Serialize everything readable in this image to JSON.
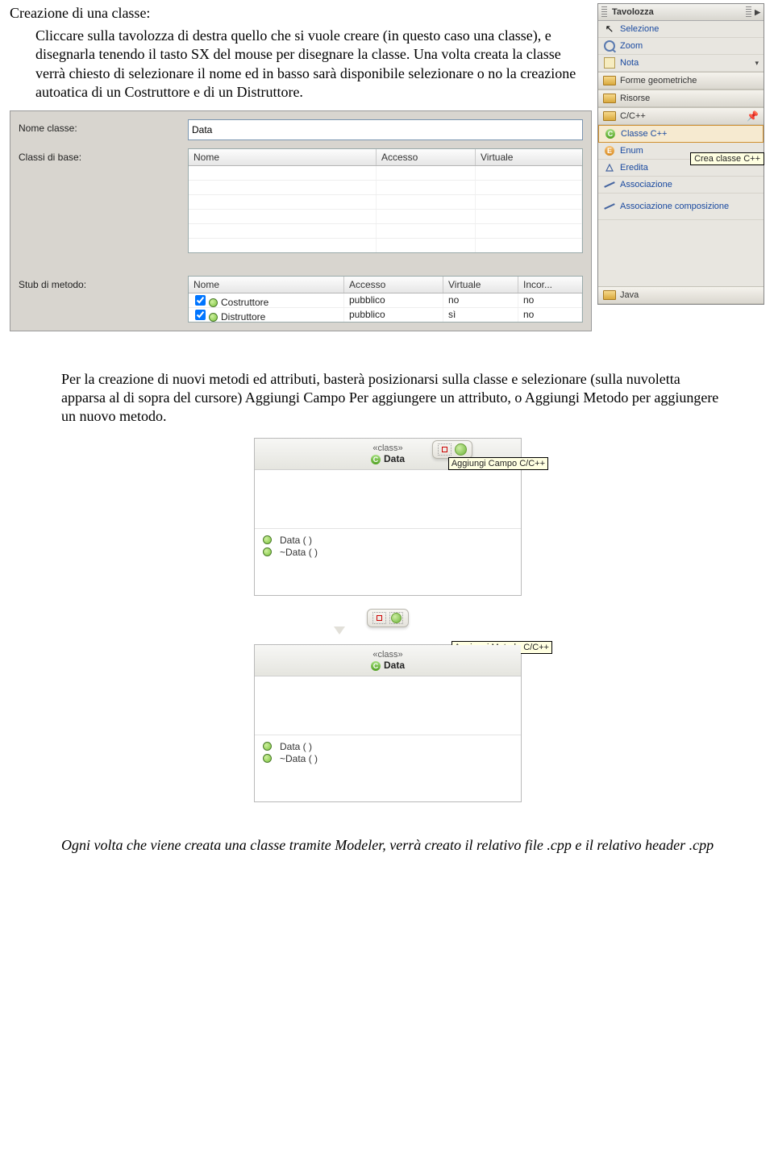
{
  "intro": {
    "heading": "Creazione di una classe:",
    "p1": "Cliccare sulla tavolozza di destra quello che si vuole creare (in questo caso una classe), e disegnarla tenendo il tasto SX del mouse per disegnare la classe. Una volta creata la classe verrà chiesto di selezionare il nome ed in basso sarà disponibile selezionare o no la creazione autoatica di un Costruttore e di un Distruttore."
  },
  "dialog1": {
    "nome_label": "Nome classe:",
    "nome_value": "Data",
    "base_label": "Classi di base:",
    "base_cols": {
      "nome": "Nome",
      "accesso": "Accesso",
      "virtuale": "Virtuale"
    },
    "stub_label": "Stub di metodo:",
    "stub_cols": {
      "nome": "Nome",
      "accesso": "Accesso",
      "virtuale": "Virtuale",
      "incor": "Incor..."
    },
    "stubs": [
      {
        "nome": "Costruttore",
        "accesso": "pubblico",
        "virtuale": "no",
        "incor": "no"
      },
      {
        "nome": "Distruttore",
        "accesso": "pubblico",
        "virtuale": "sì",
        "incor": "no"
      }
    ]
  },
  "palette": {
    "title": "Tavolozza",
    "items_top": [
      {
        "icon": "cursor",
        "label": "Selezione"
      },
      {
        "icon": "zoom",
        "label": "Zoom"
      },
      {
        "icon": "note",
        "label": "Nota",
        "arrow": true
      }
    ],
    "cats": [
      {
        "label": "Forme geometriche"
      },
      {
        "label": "Risorse"
      },
      {
        "label": "C/C++",
        "pin": true
      }
    ],
    "cpp_items": [
      {
        "icon": "cg",
        "label": "Classe C++",
        "selected": true
      },
      {
        "icon": "co",
        "label": "Enum"
      },
      {
        "icon": "tri",
        "label": "Eredita"
      },
      {
        "icon": "line",
        "label": "Associazione"
      },
      {
        "icon": "line",
        "label": "Associazione composizione",
        "multiline": true
      }
    ],
    "java_cat": "Java",
    "tooltip": "Crea classe C++"
  },
  "mid": {
    "p1": "Per la creazione di nuovi metodi ed attributi, basterà posizionarsi sulla classe e selezionare (sulla nuvoletta apparsa al di sopra del cursore) Aggiungi Campo Per aggiungere un attributo, o Aggiungi Metodo per aggiungere un nuovo metodo."
  },
  "class1": {
    "stereo": "«class»",
    "name": "Data",
    "methods": [
      "Data ( )",
      "~Data ( )"
    ],
    "tooltip": "Aggiungi Campo C/C++"
  },
  "class2": {
    "stereo": "«class»",
    "name": "Data",
    "methods": [
      "Data ( )",
      "~Data ( )"
    ],
    "tooltip": "Aggiungi Metodo C/C++"
  },
  "outro": {
    "p1_a": "Ogni volta che viene creata una classe tramite Modeler, verrà creato il relativo file .cpp e il relativo header .cpp"
  }
}
